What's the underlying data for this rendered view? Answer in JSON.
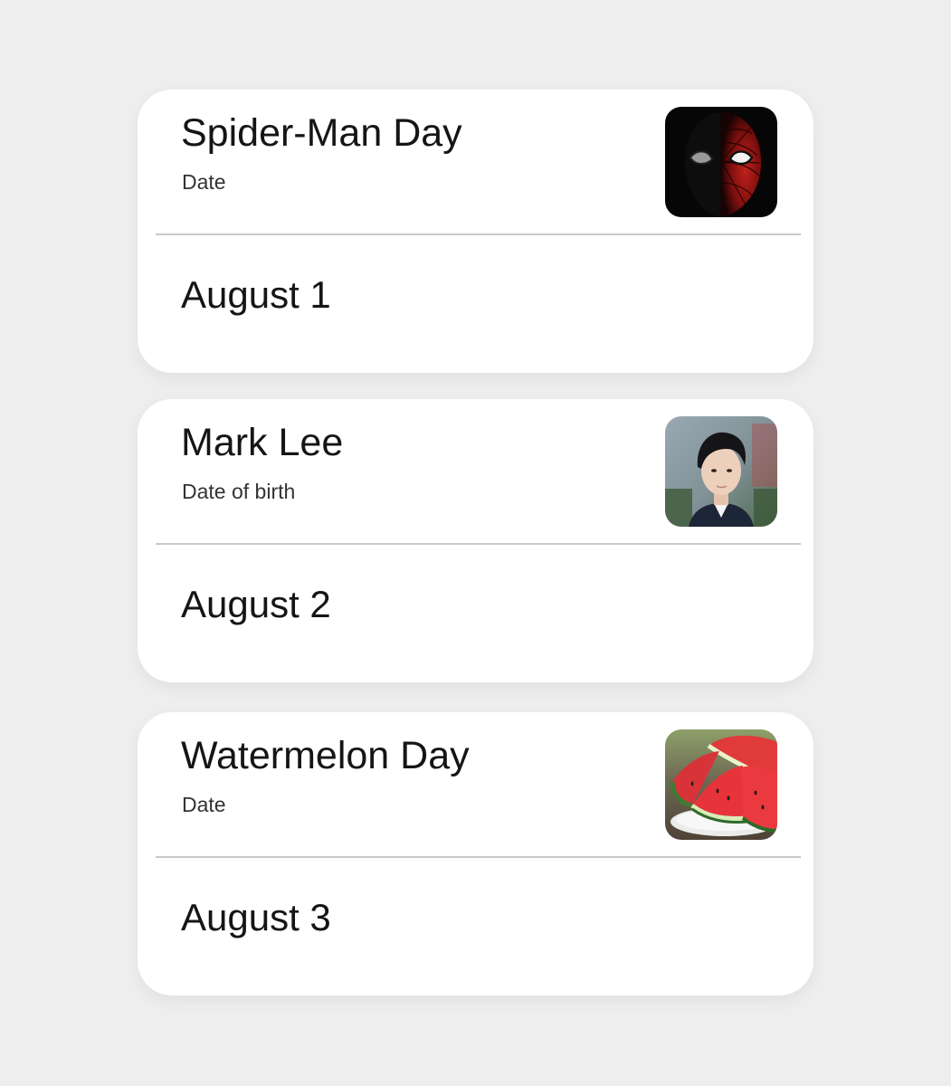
{
  "cards": [
    {
      "title": "Spider-Man Day",
      "subtitle": "Date",
      "value": "August 1",
      "thumbnail": "spider-man-mask-image"
    },
    {
      "title": "Mark Lee",
      "subtitle": "Date of birth",
      "value": "August 2",
      "thumbnail": "person-portrait-image"
    },
    {
      "title": "Watermelon Day",
      "subtitle": "Date",
      "value": "August 3",
      "thumbnail": "watermelon-slices-image"
    }
  ],
  "colors": {
    "background": "#eeeeee",
    "card": "#ffffff",
    "divider": "#c9c9c9",
    "text": "#151515"
  }
}
